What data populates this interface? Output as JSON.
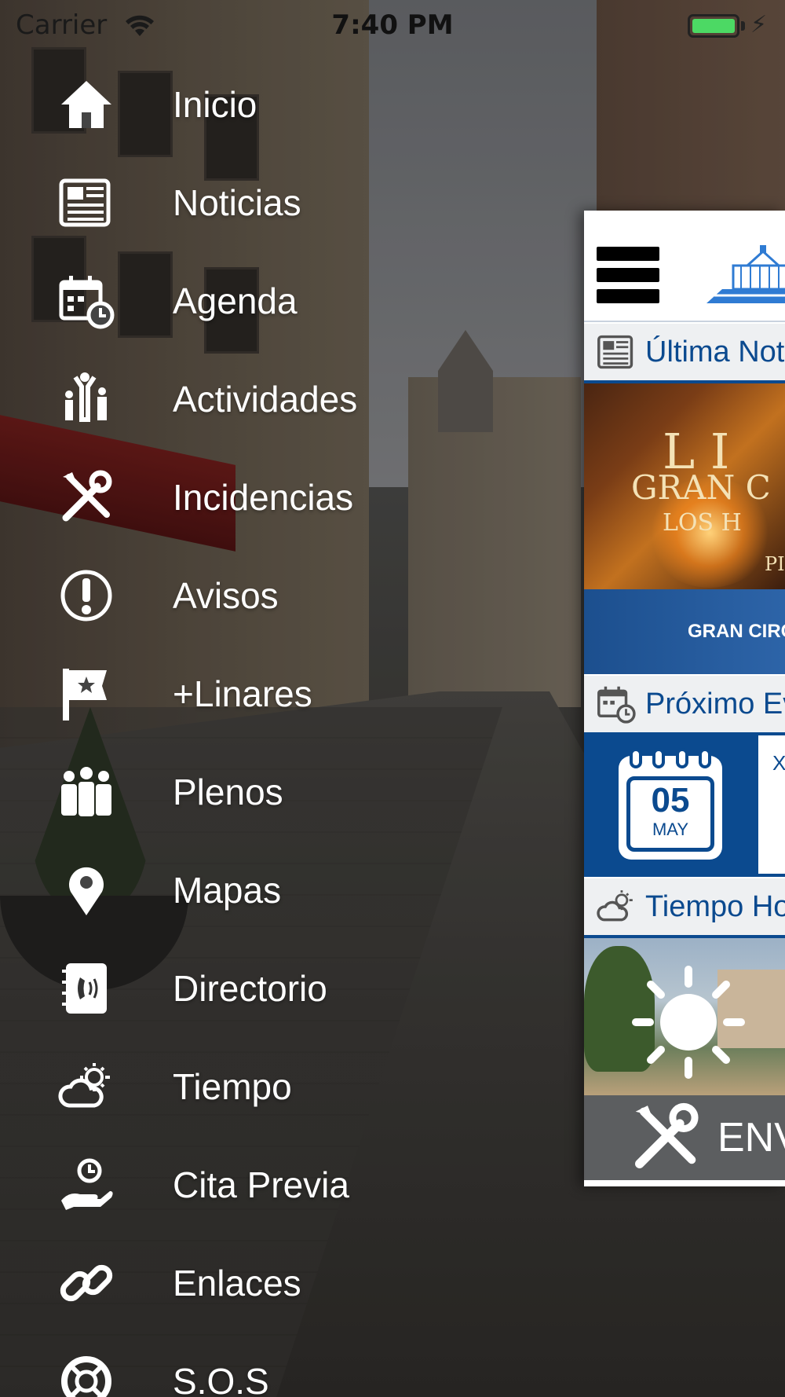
{
  "status_bar": {
    "carrier": "Carrier",
    "time": "7:40 PM",
    "battery_level": 1.0
  },
  "menu": {
    "items": [
      {
        "label": "Inicio",
        "icon": "home-icon"
      },
      {
        "label": "Noticias",
        "icon": "newspaper-icon"
      },
      {
        "label": "Agenda",
        "icon": "calendar-clock-icon"
      },
      {
        "label": "Actividades",
        "icon": "family-icon"
      },
      {
        "label": "Incidencias",
        "icon": "tools-icon"
      },
      {
        "label": "Avisos",
        "icon": "alert-icon"
      },
      {
        "label": "+Linares",
        "icon": "flag-star-icon"
      },
      {
        "label": "Plenos",
        "icon": "group-icon"
      },
      {
        "label": "Mapas",
        "icon": "map-pin-icon"
      },
      {
        "label": "Directorio",
        "icon": "phonebook-icon"
      },
      {
        "label": "Tiempo",
        "icon": "weather-icon"
      },
      {
        "label": "Cita Previa",
        "icon": "appointment-icon"
      },
      {
        "label": "Enlaces",
        "icon": "link-icon"
      },
      {
        "label": "S.O.S",
        "icon": "lifebuoy-icon"
      }
    ]
  },
  "main": {
    "sections": {
      "latest_news": "Última Not",
      "next_event": "Próximo Ev",
      "weather_today": "Tiempo Ho"
    },
    "news": {
      "caption": "GRAN CIRC"
    },
    "event": {
      "day": "05",
      "month": "MAY",
      "text": "X"
    },
    "incident_button": "ENV"
  },
  "colors": {
    "brand_blue": "#0b4a8f",
    "section_bg": "#eef0f2",
    "incident_bar": "#5c5e60",
    "battery": "#4cd964"
  }
}
